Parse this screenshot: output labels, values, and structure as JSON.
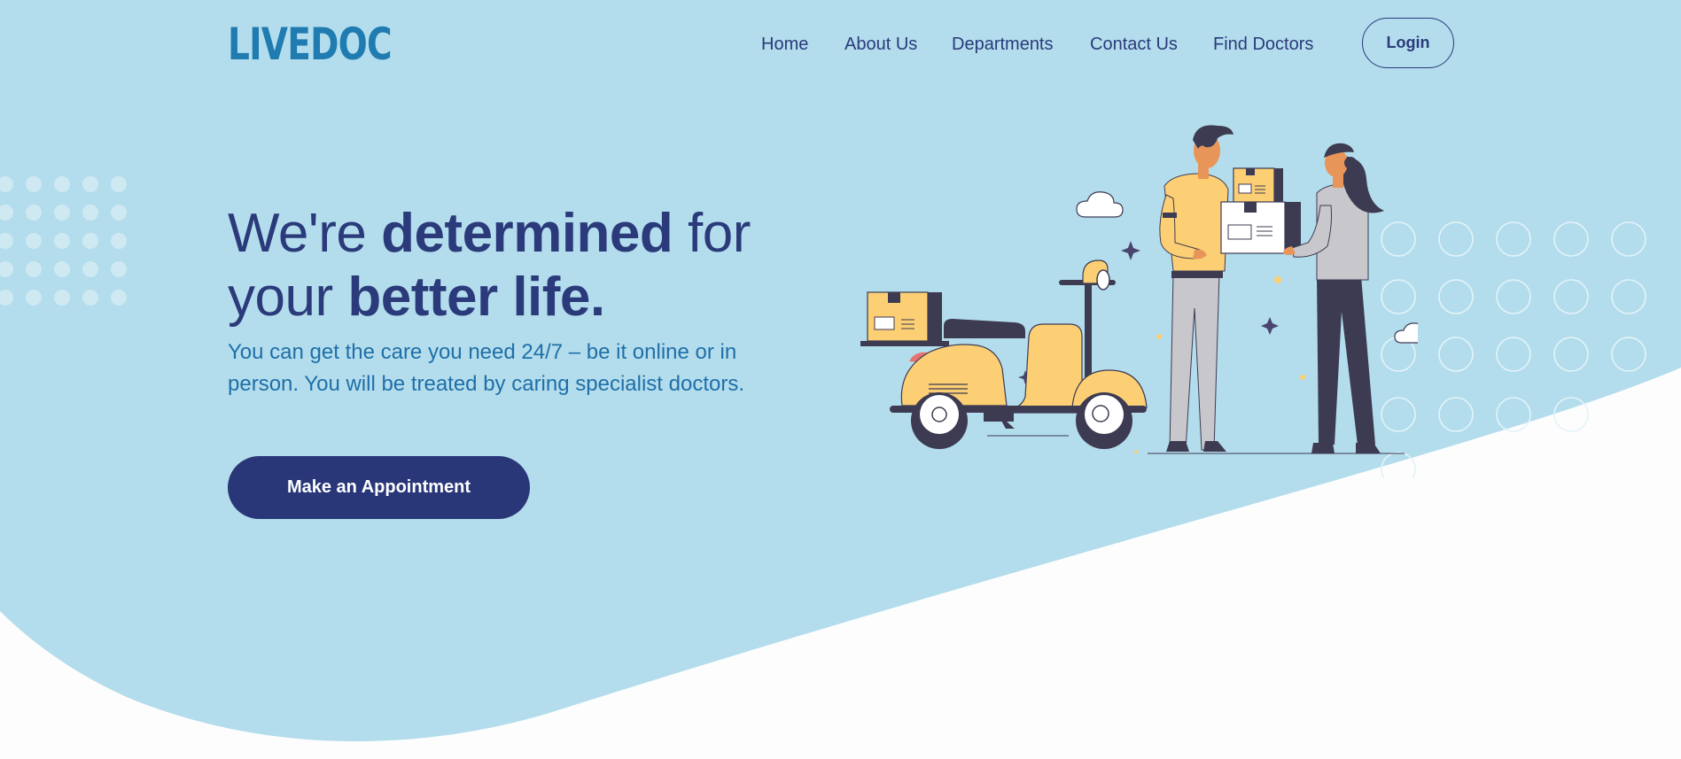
{
  "brand": {
    "logo_text": "LIVEDOC"
  },
  "nav": {
    "links": [
      {
        "label": "Home"
      },
      {
        "label": "About Us"
      },
      {
        "label": "Departments"
      },
      {
        "label": "Contact Us"
      },
      {
        "label": "Find Doctors"
      }
    ],
    "login_label": "Login"
  },
  "hero": {
    "headline": {
      "part1": "We're ",
      "bold1": "determined",
      "part2": " for",
      "part3": "your ",
      "bold2": "better life."
    },
    "subtext": "You can get the care you need 24/7 – be it online or in person. You will be treated by caring specialist doctors.",
    "cta_label": "Make an Appointment"
  },
  "colors": {
    "background_blue": "#b3ddec",
    "navy": "#293779",
    "logo_blue": "#1f7bb0",
    "accent_yellow": "#fdcf74",
    "dark_figure": "#3d3b52"
  }
}
